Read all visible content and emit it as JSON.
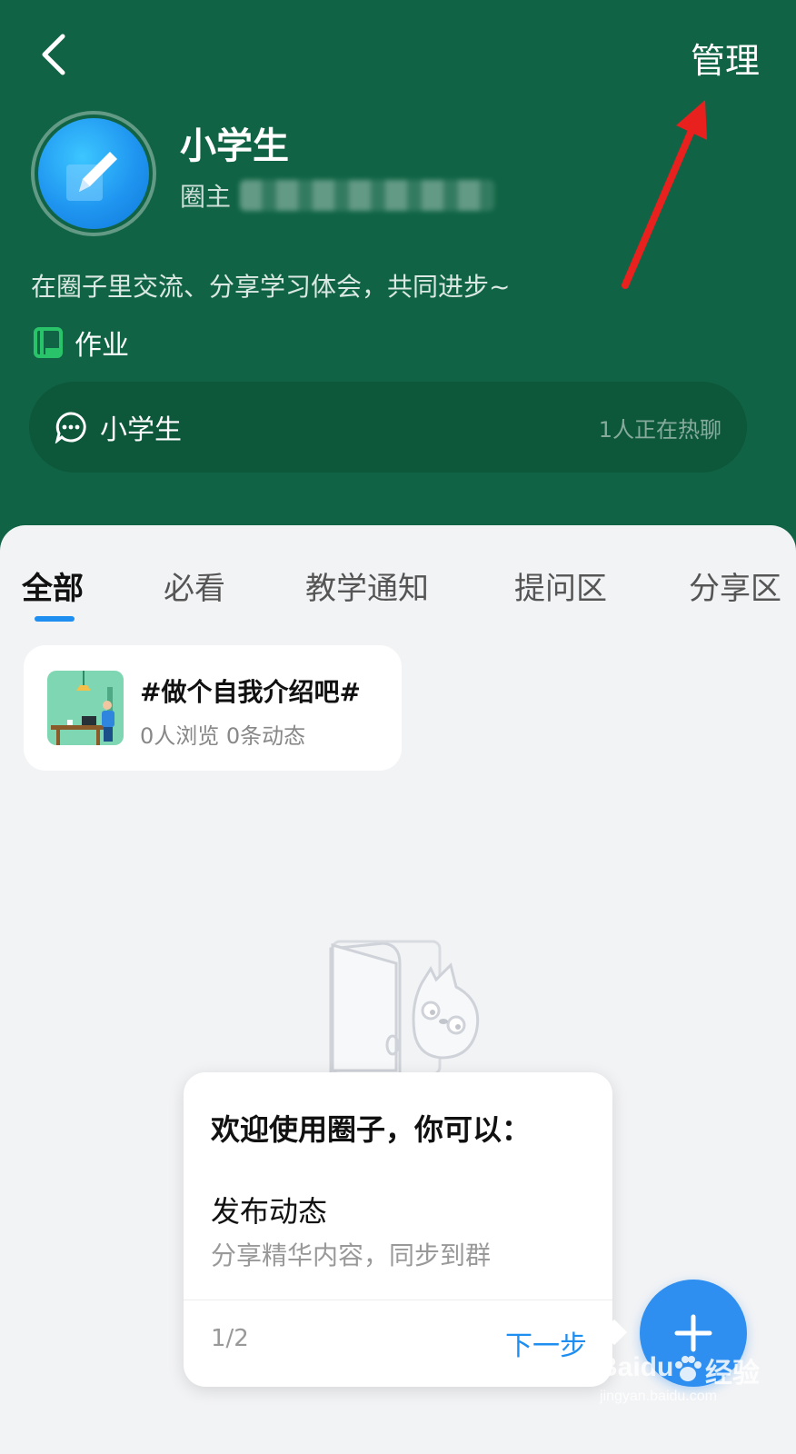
{
  "colors": {
    "header_bg": "#106445",
    "accent": "#1f8ef1",
    "annotation": "#e8201e"
  },
  "header": {
    "manage_label": "管理",
    "circle_name": "小学生",
    "owner_label": "圈主",
    "description": "在圈子里交流、分享学习体会，共同进步~",
    "tag_label": "作业"
  },
  "chat": {
    "name": "小学生",
    "status": "1人正在热聊"
  },
  "tabs": [
    {
      "label": "全部",
      "active": true
    },
    {
      "label": "必看",
      "active": false
    },
    {
      "label": "教学通知",
      "active": false
    },
    {
      "label": "提问区",
      "active": false
    },
    {
      "label": "分享区",
      "active": false
    }
  ],
  "topic": {
    "title": "#做个自我介绍吧#",
    "stats": "0人浏览 0条动态"
  },
  "popover": {
    "title": "欢迎使用圈子，你可以：",
    "action_title": "发布动态",
    "action_desc": "分享精华内容，同步到群",
    "page": "1/2",
    "next_label": "下一步"
  },
  "watermark": {
    "brand": "Baidu",
    "cn": "经验",
    "url": "jingyan.baidu.com"
  }
}
